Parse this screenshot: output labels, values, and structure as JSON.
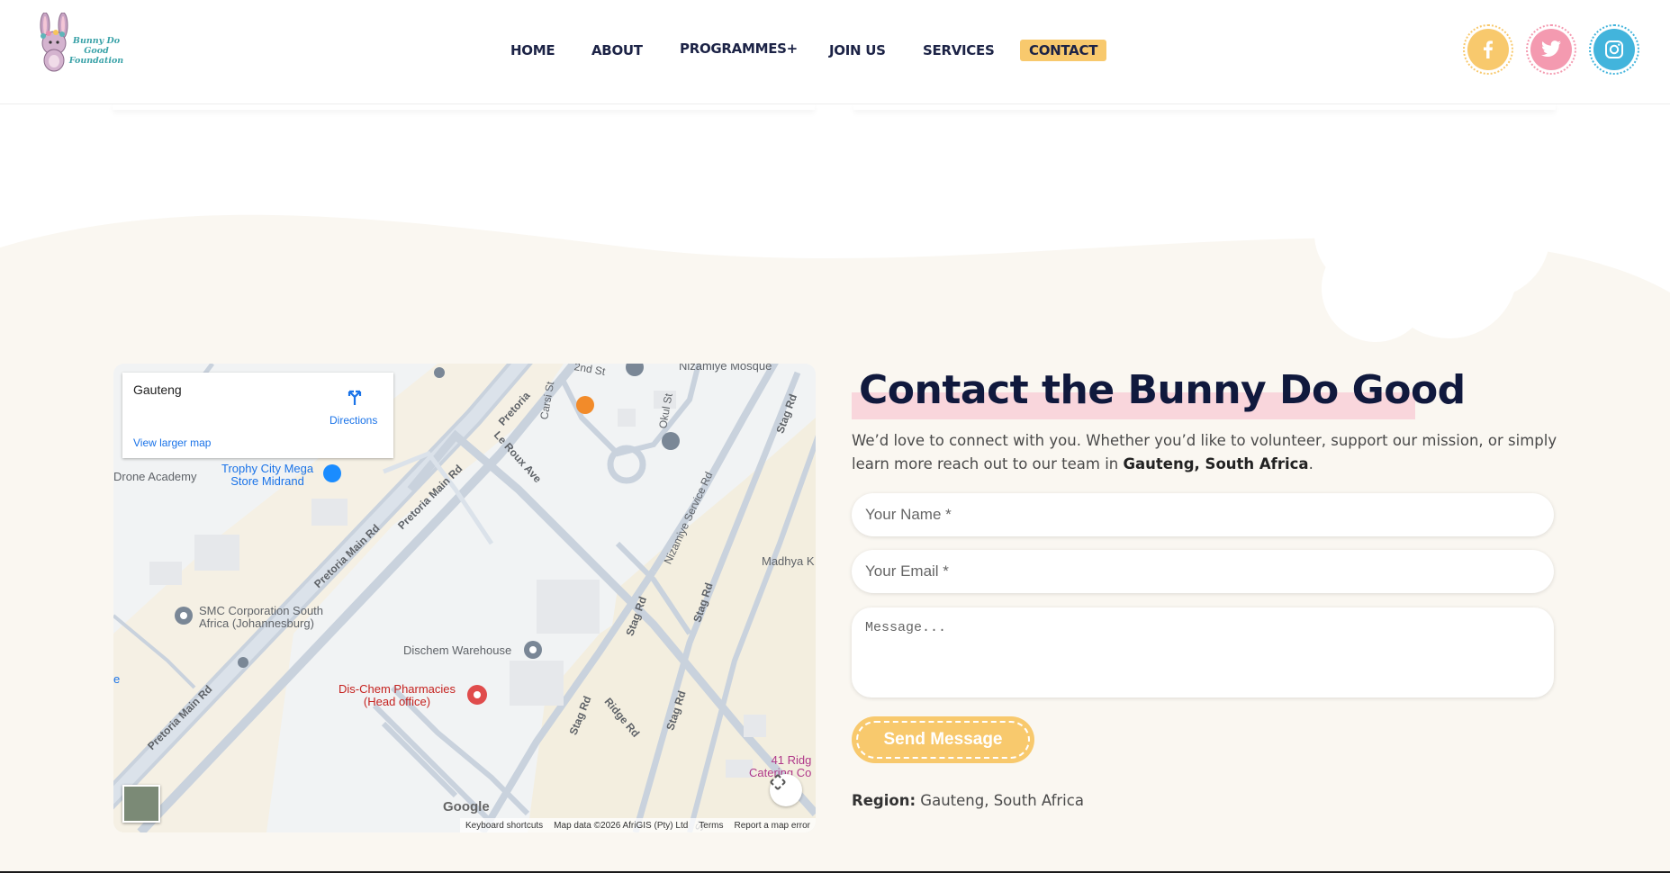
{
  "brand": {
    "name_line1": "Bunny Do Good",
    "name_line2": "Foundation"
  },
  "nav": {
    "home": "HOME",
    "about": "ABOUT",
    "programmes": "PROGRAMMES",
    "programmes_plus": "+",
    "join": "JOIN US",
    "services": "SERVICES",
    "contact": "CONTACT"
  },
  "social": [
    {
      "icon": "facebook-icon",
      "color": "#f8c96d"
    },
    {
      "icon": "twitter-icon",
      "color": "#f49ab0"
    },
    {
      "icon": "instagram-icon",
      "color": "#42b4dc"
    }
  ],
  "map": {
    "place": "Gauteng",
    "directions": "Directions",
    "view_larger": "View larger map",
    "labels": {
      "trophy_1": "Trophy City Mega",
      "trophy_2": "Store Midrand",
      "drone": "Drone Academy",
      "mosque": "Nizamiye Mosque",
      "smc_1": "SMC Corporation South",
      "smc_2": "Africa (Johannesburg)",
      "dischem_wh": "Dischem Warehouse",
      "dischem_1": "Dis-Chem Pharmacies",
      "dischem_2": "(Head office)",
      "madhya": "Madhya K",
      "ridge_1": "41 Ridg",
      "ridge_2": "Catering Co",
      "edge_e": "e"
    },
    "roads": {
      "pretoria1": "Pretoria Main Rd",
      "pretoria2": "Pretoria Main Rd",
      "pretoria3": "Pretoria Main Rd",
      "pretoria4": "Pretoria",
      "leroux": "Le Roux Ave",
      "carsi": "Carsi St",
      "okul": "Okul St",
      "nizamiye": "Nizamiye Service Rd",
      "stag1": "Stag Rd",
      "stag2": "Stag Rd",
      "stag3": "Stag Rd",
      "stag4": "Stag Rd",
      "stag5": "Stag Rd",
      "ridge": "Ridge Rd",
      "second": "2nd St",
      "st": "St"
    },
    "google": "Google",
    "attribution": {
      "shortcuts": "Keyboard shortcuts",
      "data": "Map data ©2026 AfriGIS (Pty) Ltd",
      "terms": "Terms",
      "report": "Report a map error"
    }
  },
  "contact": {
    "title": "Contact the Bunny Do Good",
    "intro_text": "We’d love to connect with you. Whether you’d like to volunteer, support our mission, or simply learn more reach out to our team in ",
    "intro_bold": "Gauteng, South Africa",
    "intro_end": ".",
    "name_placeholder": "Your Name *",
    "email_placeholder": "Your Email *",
    "message_placeholder": "Message...",
    "send_label": "Send Message",
    "region_label": "Region:",
    "region_value": "Gauteng, South Africa"
  },
  "colors": {
    "cream": "#faf7f1",
    "navy": "#10193d",
    "yellow": "#f8c96d",
    "pink_highlight": "#f9d6dc"
  }
}
